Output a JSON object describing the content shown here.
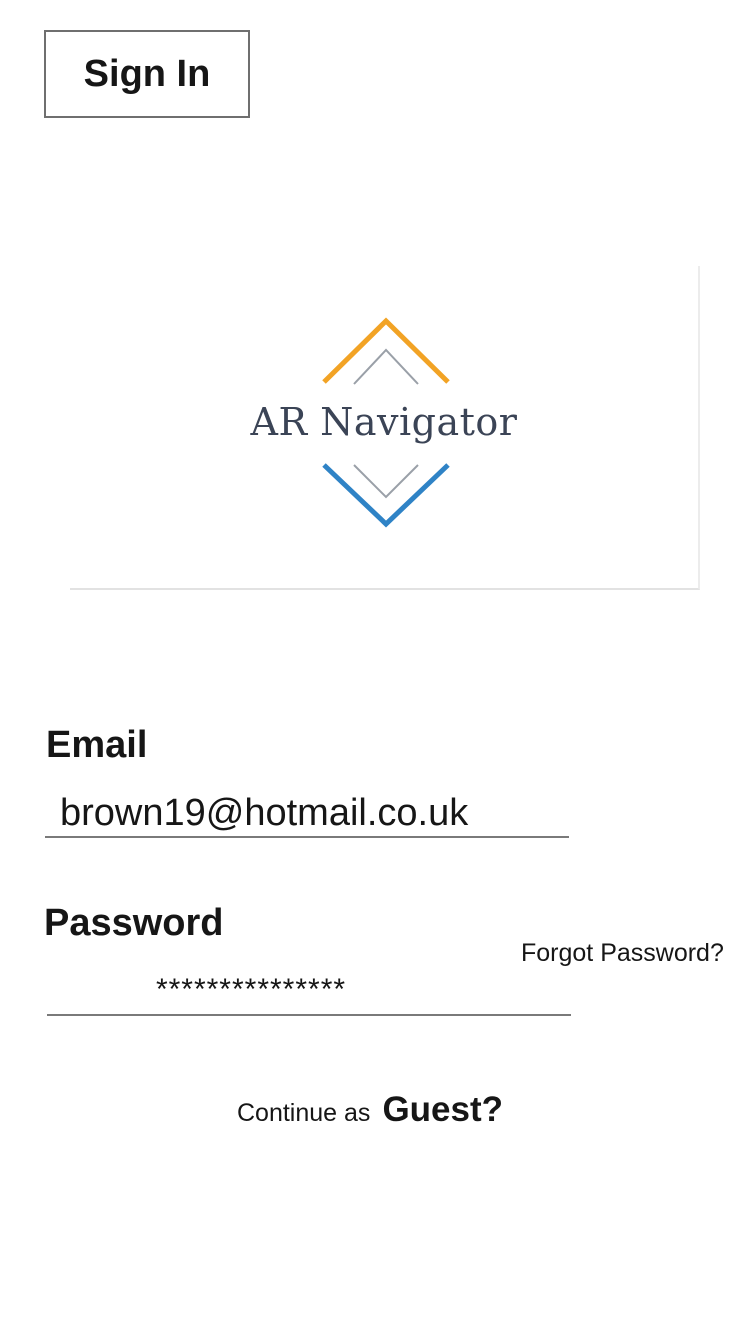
{
  "header": {
    "sign_in_label": "Sign In"
  },
  "logo": {
    "text": "AR Navigator",
    "icon": "diamond-chevrons-icon",
    "colors": {
      "top_chevron": "#f2a325",
      "bottom_chevron": "#2f83c6",
      "inner_chevron": "#9aa0a8",
      "text": "#3b4456"
    }
  },
  "form": {
    "email_label": "Email",
    "email_value": "brown19@hotmail.co.uk",
    "password_label": "Password",
    "password_value": "***************",
    "forgot_password_label": "Forgot Password?"
  },
  "guest": {
    "prefix": "Continue as",
    "link_label": "Guest?"
  }
}
